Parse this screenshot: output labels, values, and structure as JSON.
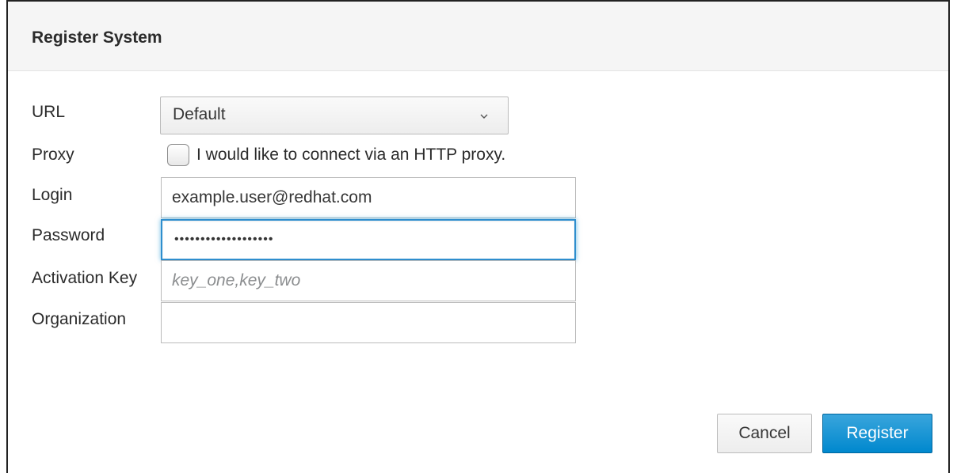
{
  "dialog": {
    "title": "Register System"
  },
  "form": {
    "url": {
      "label": "URL",
      "selected": "Default"
    },
    "proxy": {
      "label": "Proxy",
      "checkbox_label": "I would like to connect via an HTTP proxy.",
      "checked": false
    },
    "login": {
      "label": "Login",
      "value": "example.user@redhat.com"
    },
    "password": {
      "label": "Password",
      "masked_value": "•••••••••••••••••••"
    },
    "activation_key": {
      "label": "Activation Key",
      "placeholder": "key_one,key_two",
      "value": ""
    },
    "organization": {
      "label": "Organization",
      "value": ""
    }
  },
  "footer": {
    "cancel_label": "Cancel",
    "register_label": "Register"
  },
  "colors": {
    "primary": "#0088ce",
    "focus_border": "#2e8ece",
    "header_bg": "#f5f5f5"
  },
  "icons": {
    "select_chevron": "chevron-down-icon"
  }
}
